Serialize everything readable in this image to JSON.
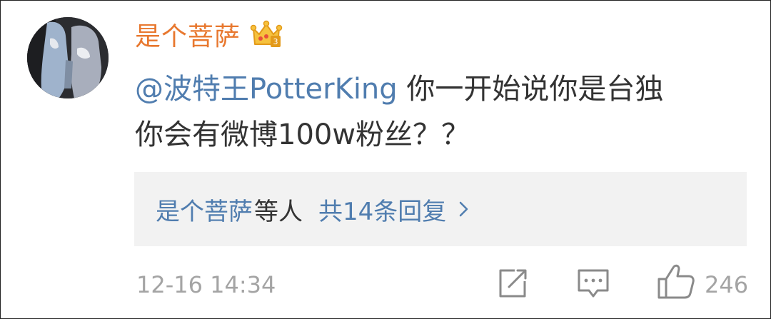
{
  "comment": {
    "username": "是个菩萨",
    "mention": "@波特王PotterKing",
    "text_line1": " 你一开始说你是台独",
    "text_line2": "你会有微博100w粉丝？？"
  },
  "replies": {
    "names": "是个菩萨",
    "etc": "等人",
    "count_label": "共14条回复"
  },
  "footer": {
    "timestamp": "12-16 14:34",
    "like_count": "246"
  },
  "colors": {
    "username": "#e8782f",
    "link": "#507daf",
    "text": "#333333",
    "muted": "#a4a4a4",
    "reply_bg": "#f2f2f2"
  },
  "icons": {
    "badge": "crown-badge-icon",
    "share": "share-icon",
    "comment": "comment-icon",
    "like": "thumbs-up-icon",
    "chevron": "chevron-right-icon"
  }
}
